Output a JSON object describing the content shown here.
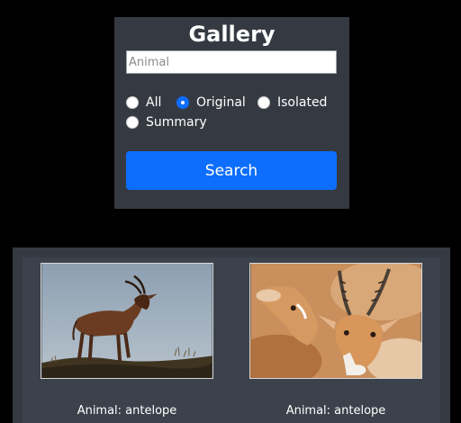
{
  "search_panel": {
    "title": "Gallery",
    "search_placeholder": "Animal",
    "search_value": "",
    "filters": [
      {
        "label": "All",
        "checked": false
      },
      {
        "label": "Original",
        "checked": true
      },
      {
        "label": "Isolated",
        "checked": false
      },
      {
        "label": "Summary",
        "checked": false
      }
    ],
    "search_button_label": "Search"
  },
  "gallery": {
    "items": [
      {
        "caption": "Animal: antelope",
        "image_subject": "antelope-standing-on-hill"
      },
      {
        "caption": "Animal: antelope",
        "image_subject": "two-antelopes-closeup"
      }
    ]
  },
  "colors": {
    "page_background": "#000000",
    "panel_background": "#353a42",
    "accent": "#0d6efd"
  }
}
